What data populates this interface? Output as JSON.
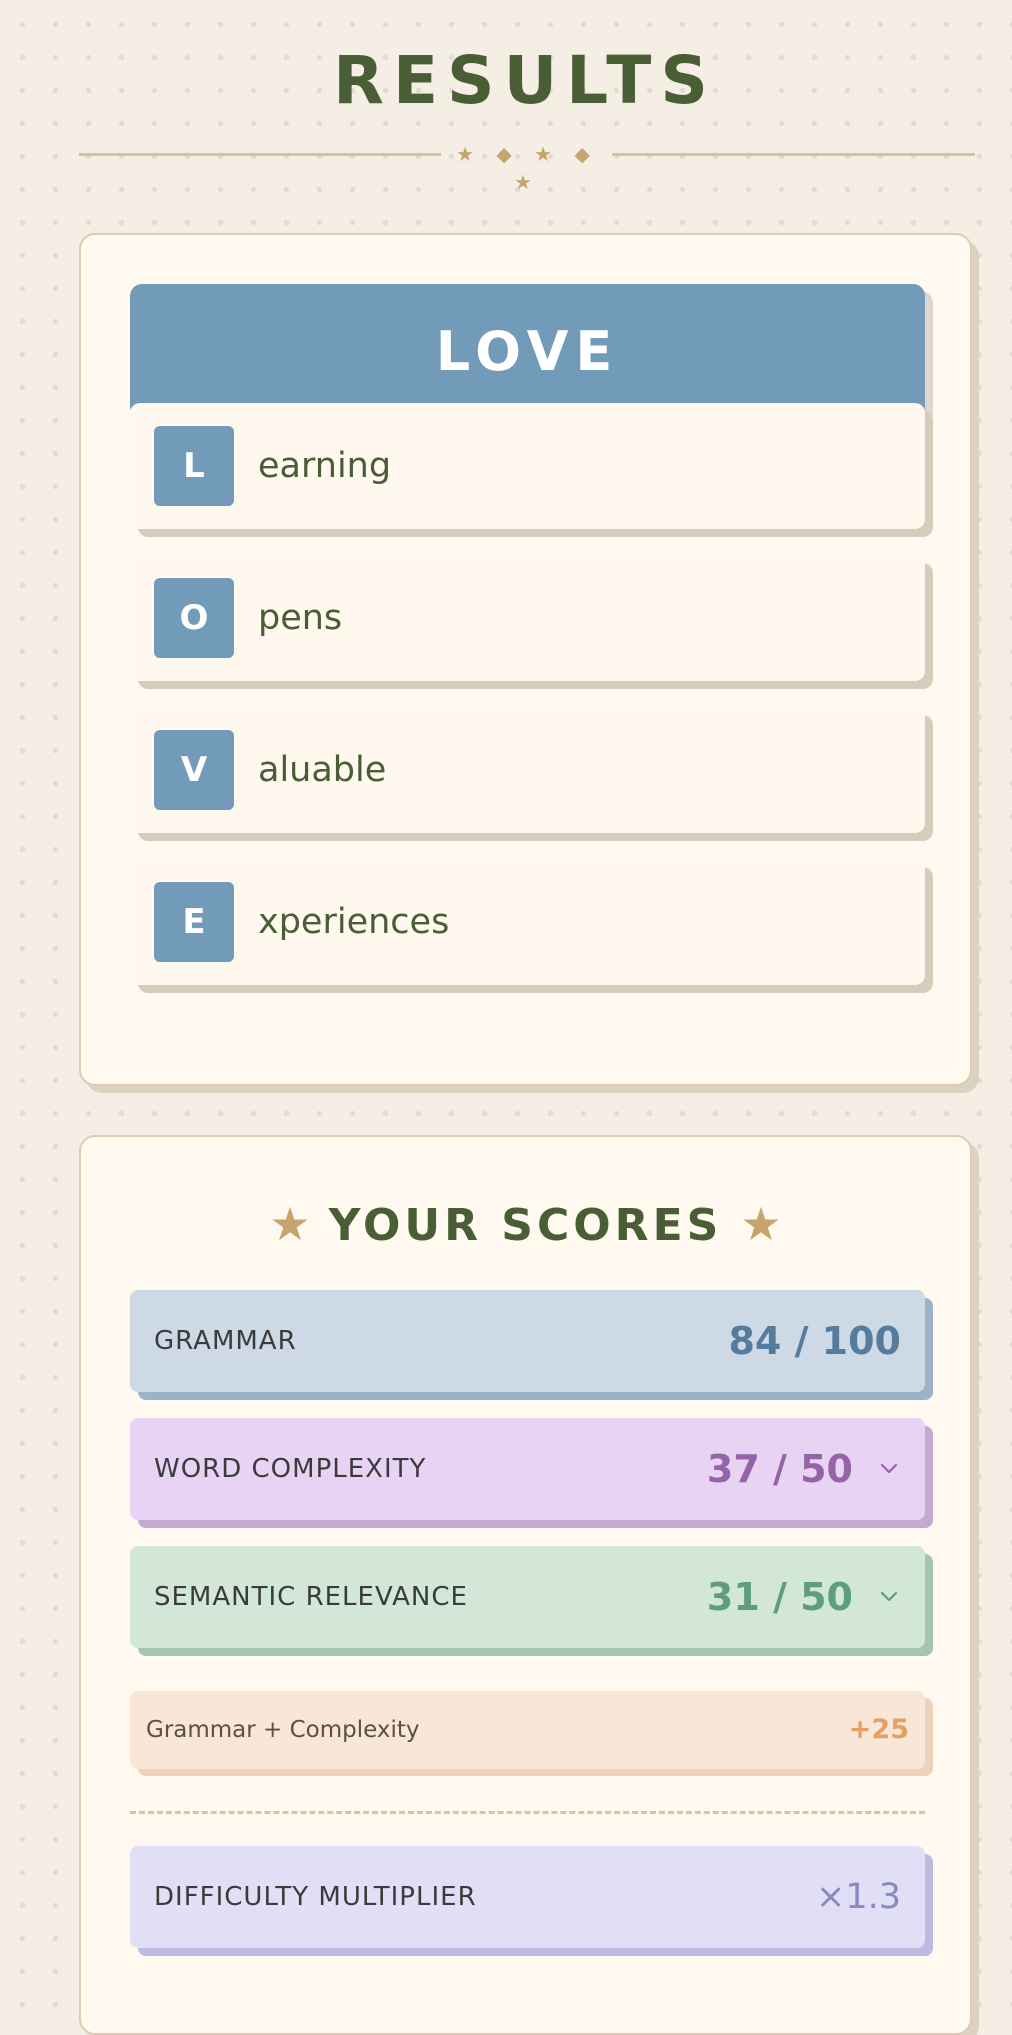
{
  "header": {
    "title": "RESULTS",
    "ornament": "★ ◆ ★ ◆ ★"
  },
  "word_card": {
    "word": "LOVE",
    "rows": [
      {
        "letter": "L",
        "rest": "earning"
      },
      {
        "letter": "O",
        "rest": "pens"
      },
      {
        "letter": "V",
        "rest": "aluable"
      },
      {
        "letter": "E",
        "rest": "xperiences"
      }
    ]
  },
  "scores_card": {
    "star": "★",
    "title": "YOUR SCORES",
    "grammar": {
      "label": "GRAMMAR",
      "value": "84 / 100"
    },
    "complexity": {
      "label": "WORD COMPLEXITY",
      "value": "37 / 50",
      "icon": "chevron-down-icon"
    },
    "semantic": {
      "label": "SEMANTIC RELEVANCE",
      "value": "31 / 50",
      "icon": "chevron-down-icon"
    },
    "bonus": {
      "label": "Grammar + Complexity",
      "value": "+25"
    },
    "multiplier": {
      "label": "DIFFICULTY MULTIPLIER",
      "value": "×1.3"
    }
  },
  "colors": {
    "background": "#f5eee5",
    "title_green": "#4a5e36",
    "accent_blue": "#729ab9",
    "gold": "#c4a56d",
    "grammar": "#557b9d",
    "complexity": "#9563a8",
    "semantic": "#5e9e7e",
    "bonus": "#e4a062",
    "multiplier": "#8b86c4"
  }
}
